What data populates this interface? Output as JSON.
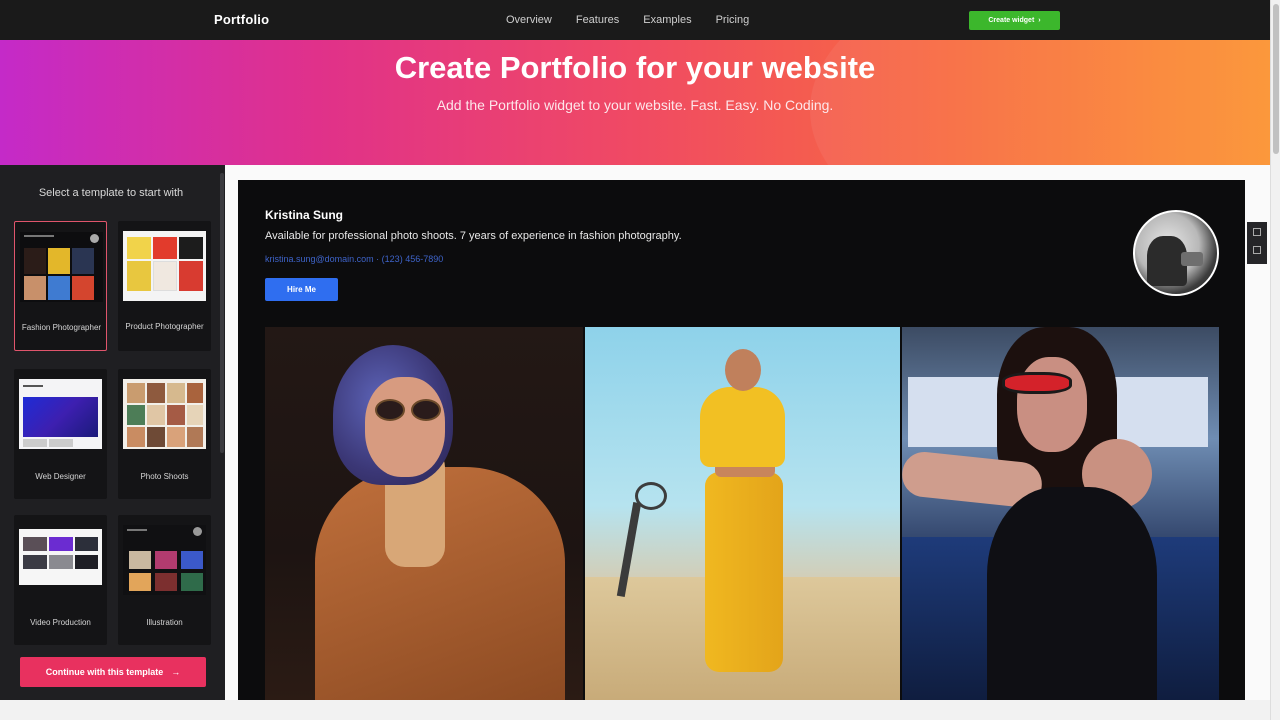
{
  "nav": {
    "logo": "Portfolio",
    "links": [
      "Overview",
      "Features",
      "Examples",
      "Pricing"
    ],
    "cta": "Create widget",
    "cta_arrow": "›"
  },
  "hero": {
    "title": "Create Portfolio for your website",
    "subtitle": "Add the Portfolio widget to your website. Fast. Easy. No Coding."
  },
  "sidebar": {
    "title": "Select a template to start with",
    "templates": [
      {
        "label": "Fashion Photographer",
        "selected": true
      },
      {
        "label": "Product Photographer",
        "selected": false
      },
      {
        "label": "Web Designer",
        "selected": false
      },
      {
        "label": "Photo Shoots",
        "selected": false
      },
      {
        "label": "Video Production",
        "selected": false
      },
      {
        "label": "Illustration",
        "selected": false
      }
    ],
    "continue_label": "Continue with this template",
    "continue_arrow": "→"
  },
  "preview": {
    "name": "Kristina Sung",
    "description": "Available for professional photo shoots. 7 years of experience in fashion photography.",
    "contact": "kristina.sung@domain.com  ·  (123) 456-7890",
    "hire_label": "Hire Me"
  },
  "colors": {
    "accent_pink": "#e8315f",
    "accent_green": "#3cb72c",
    "accent_blue": "#2f6ef0",
    "hero_start": "#c42ac8",
    "hero_end": "#fb9230"
  }
}
